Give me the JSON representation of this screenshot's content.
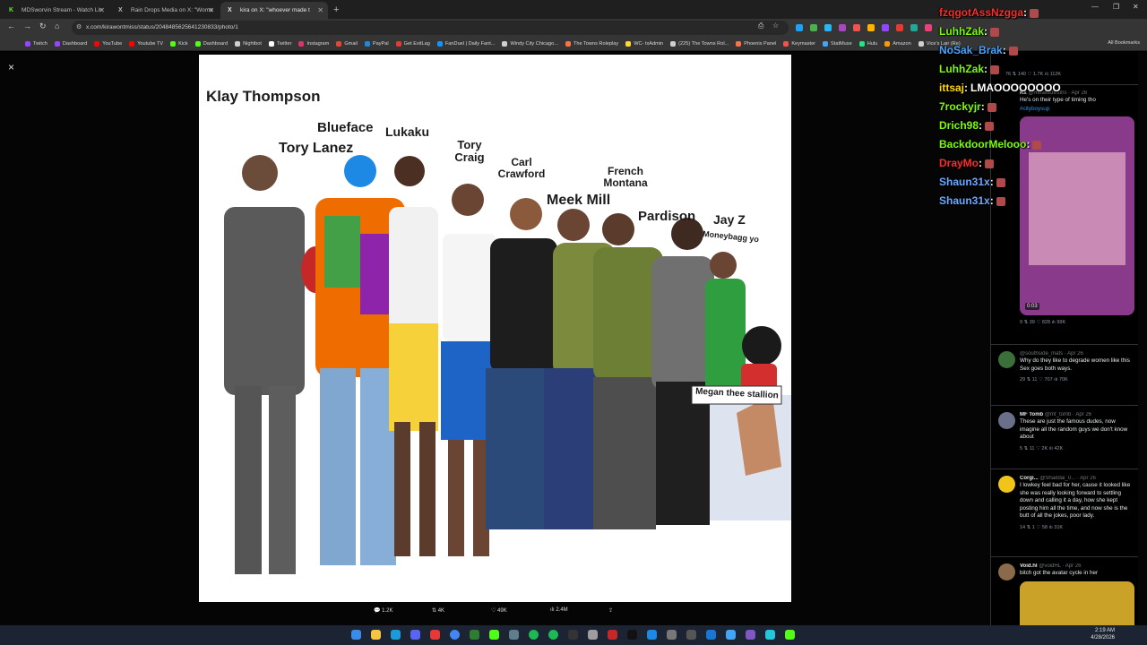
{
  "browser": {
    "tabs": [
      {
        "label": "MDSworvin Stream - Watch Liv",
        "color": "#53fc18",
        "glyph": "K",
        "active": false
      },
      {
        "label": "Rain Drops Media on X: \"Wome",
        "color": "#ffffff",
        "glyph": "X",
        "active": false
      },
      {
        "label": "kira on X: \"whoever made t",
        "color": "#ffffff",
        "glyph": "X",
        "active": true
      }
    ],
    "new_tab": "+",
    "url": "x.com/kirawontmiss/status/2048485625641230833/photo/1",
    "bookmarks": [
      {
        "label": "Twitch",
        "color": "#9146ff"
      },
      {
        "label": "Dashboard",
        "color": "#9146ff"
      },
      {
        "label": "YouTube",
        "color": "#ff0000"
      },
      {
        "label": "Youtube TV",
        "color": "#ff0000"
      },
      {
        "label": "Kick",
        "color": "#53fc18"
      },
      {
        "label": "Dashboard",
        "color": "#53fc18"
      },
      {
        "label": "Nightbot",
        "color": "#cfcfcf"
      },
      {
        "label": "Twitter",
        "color": "#ffffff"
      },
      {
        "label": "Instagram",
        "color": "#e1306c"
      },
      {
        "label": "Gmail",
        "color": "#ea4335"
      },
      {
        "label": "PayPal",
        "color": "#1e88e5"
      },
      {
        "label": "Get ExitLag",
        "color": "#e53935"
      },
      {
        "label": "FanDuel | Daily Fant...",
        "color": "#1493ff"
      },
      {
        "label": "Windy City Chicago...",
        "color": "#cfcfcf"
      },
      {
        "label": "The Towns Roleplay",
        "color": "#ff7043"
      },
      {
        "label": "WC- txAdmin",
        "color": "#fdd835"
      },
      {
        "label": "(225) The Towns Rol...",
        "color": "#cfcfcf"
      },
      {
        "label": "Phoenix Panel",
        "color": "#ff7043"
      },
      {
        "label": "Keymaster",
        "color": "#ef5350"
      },
      {
        "label": "StatMuse",
        "color": "#42a5f5"
      },
      {
        "label": "Hulu",
        "color": "#1ce783"
      },
      {
        "label": "Amazon",
        "color": "#ff9900"
      },
      {
        "label": "Vice's Lair (Re)",
        "color": "#cfcfcf"
      }
    ],
    "all_bookmarks": "All Bookmarks"
  },
  "viewer": {
    "close_icon": "×",
    "image_labels": [
      "Klay Thompson",
      "Blueface",
      "Tory Lanez",
      "Lukaku",
      "Tory Craig",
      "Carl Crawford",
      "Meek Mill",
      "French Montana",
      "Pardison",
      "Jay Z",
      "Moneybagg yo",
      "Megan thee stallion"
    ],
    "actions": {
      "replies": "1.2K",
      "reposts": "4K",
      "likes": "49K",
      "views": "2.4M"
    }
  },
  "replies": [
    {
      "name": "Rx",
      "handle": "@Relaxedtruths · Apr 26",
      "text": "He's on their type of timing tho",
      "link": "#cityboysup",
      "metrics": "9  ⇅ 39  ♡ 828  ılı 99K",
      "video_time": "0:03",
      "avatar_color": "#444"
    },
    {
      "name": "",
      "handle": "@southside_mafs · Apr 26",
      "text": "Why do they like to degrade women like this\nSex goes both ways.",
      "metrics": "29  ⇅ 11  ♡ 707  ılı 70K",
      "avatar_color": "#3c6e3a"
    },
    {
      "name": "MF Tomb",
      "handle": "@mf_tomb · Apr 26",
      "text": "These are just the famous dudes, now imagine all the random guys we don't know about",
      "metrics": "5  ⇅ 11  ♡ 2K  ılı 42K",
      "avatar_color": "#6a6f8a"
    },
    {
      "name": "Corgi...",
      "handle": "@Shaddai_0... · Apr 26",
      "text": "I lowkey feel bad for her, cause it looked like she was really looking forward to settling down and calling it a day, how she kept posting him all the time, and now she is the butt of all the jokes, poor lady.",
      "metrics": "14  ⇅ 1  ♡ 58  ılı 31K",
      "avatar_color": "#f0c419"
    },
    {
      "name": "Void.hl",
      "handle": "@voidHL · Apr 26",
      "text": "bitch got the avatar cycle in her",
      "metrics": "",
      "avatar_color": "#8a6a4a"
    }
  ],
  "top_metrics": "76  ⇅ 140  ♡ 1.7K  ılı 112K",
  "chat": [
    {
      "user": "fzqgotAssNzgga",
      "color": "#ff2a2a",
      "msg": ""
    },
    {
      "user": "LuhhZak",
      "color": "#7cfc00",
      "msg": ""
    },
    {
      "user": "NoSak_Brak",
      "color": "#4aa3ff",
      "msg": ""
    },
    {
      "user": "LuhhZak",
      "color": "#7cfc00",
      "msg": ""
    },
    {
      "user": "ittsaj",
      "color": "#ffd700",
      "msg": "LMAOOOOOOOO"
    },
    {
      "user": "7rockyjr",
      "color": "#7cfc00",
      "msg": ""
    },
    {
      "user": "Drich98",
      "color": "#7cfc00",
      "msg": ""
    },
    {
      "user": "BackdoorMelooo",
      "color": "#7cfc00",
      "msg": ""
    },
    {
      "user": "DrayMo",
      "color": "#ff2a2a",
      "msg": ""
    },
    {
      "user": "Shaun31x",
      "color": "#6aa9ff",
      "msg": ""
    },
    {
      "user": "Shaun31x",
      "color": "#6aa9ff",
      "msg": ""
    }
  ],
  "taskbar": {
    "time": "2:19 AM",
    "date": "4/28/2026"
  }
}
